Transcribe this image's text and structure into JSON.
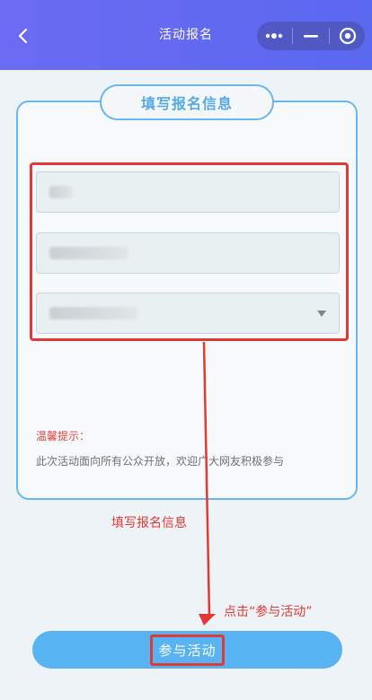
{
  "header": {
    "title": "活动报名",
    "back_icon": "chevron-left-icon",
    "menu_icons": [
      "more-icon",
      "minimize-icon",
      "close-target-icon"
    ]
  },
  "form": {
    "card_title": "填写报名信息",
    "fields": [
      {
        "type": "input",
        "value": "",
        "placeholder": ""
      },
      {
        "type": "input",
        "value": "",
        "placeholder": ""
      },
      {
        "type": "select",
        "value": "",
        "placeholder": ""
      }
    ],
    "tip_title": "温馨提示：",
    "tip_text": "此次活动面向所有公众开放，欢迎广大网友积极参与"
  },
  "annotations": {
    "form_hint": "填写报名信息",
    "button_hint": "点击“参与活动”"
  },
  "actions": {
    "join_label": "参与活动"
  },
  "colors": {
    "header_bg": "#5b68f0",
    "accent_blue": "#58b3f2",
    "annotation_red": "#e13a34"
  }
}
